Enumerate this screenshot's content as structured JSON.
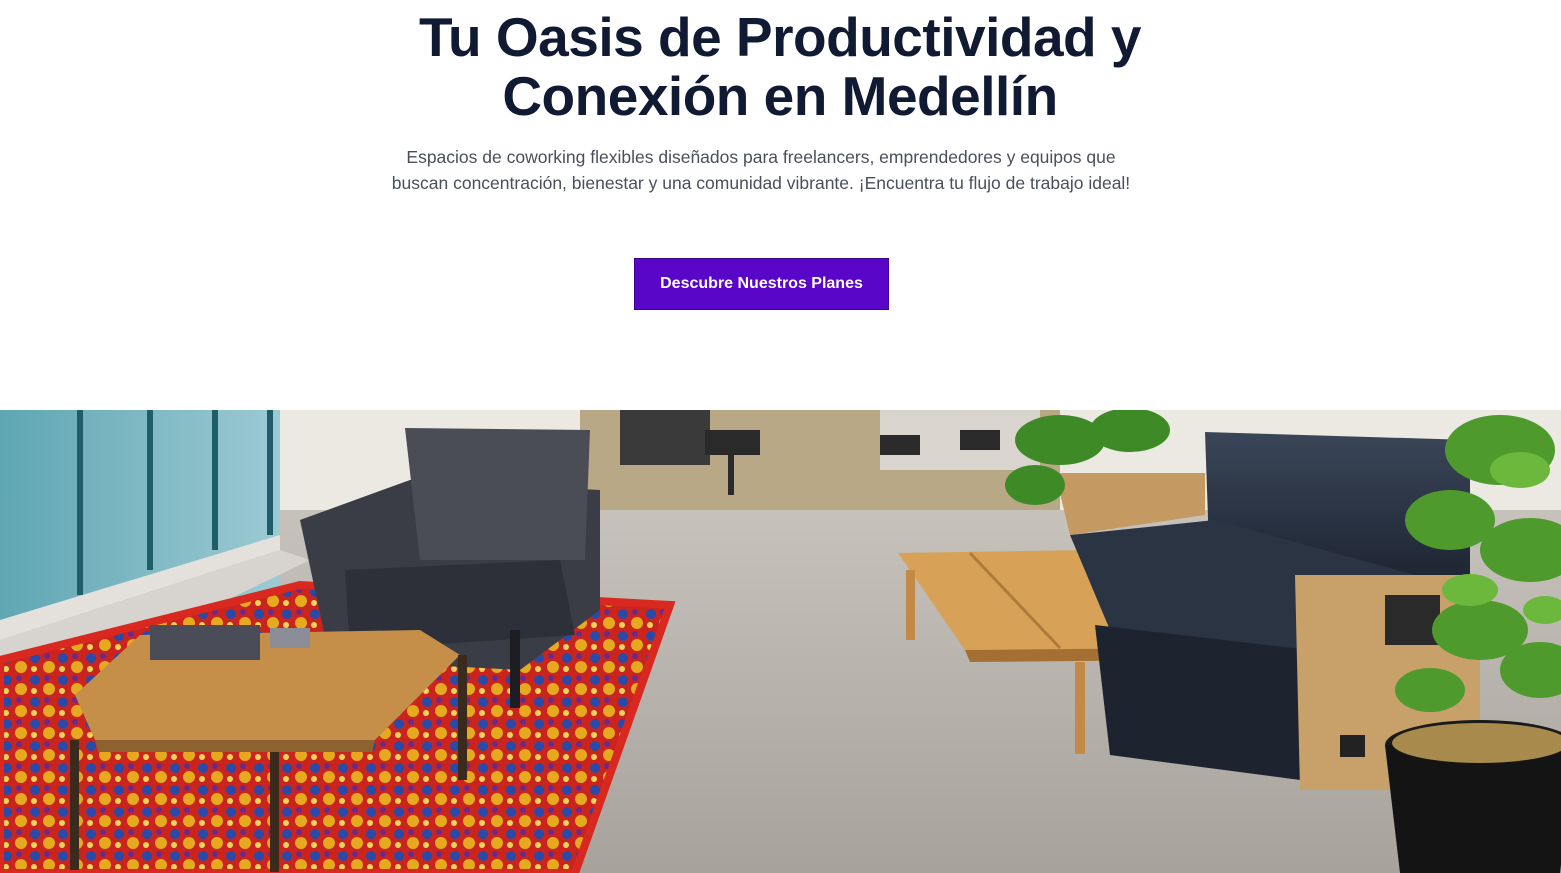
{
  "hero": {
    "title": "Tu Oasis de Productividad y Conexión en Medellín",
    "subtitle": "Espacios de coworking flexibles diseñados para freelancers, emprendedores y equipos que buscan concentración, bienestar y una comunidad vibrante. ¡Encuentra tu flujo de trabajo ideal!",
    "cta_label": "Descubre Nuestros Planes"
  },
  "colors": {
    "title": "#111a33",
    "subtitle": "#4a4f5c",
    "cta_background": "#5a06c9",
    "cta_text": "#ffffff"
  }
}
